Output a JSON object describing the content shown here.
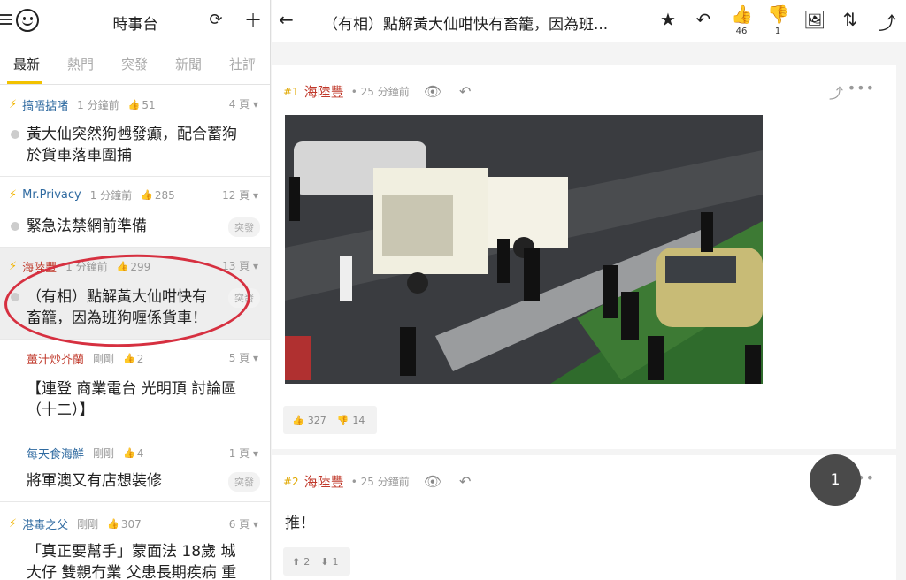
{
  "sidebar": {
    "title": "時事台",
    "tabs": [
      "最新",
      "熱門",
      "突發",
      "新聞",
      "社評"
    ],
    "topics": [
      {
        "author": "搞唔掂啫",
        "time": "1 分鐘前",
        "likes": "51",
        "pages": "4 頁",
        "title_line1": "黃大仙突然狗乸發癲，配合蓄狗",
        "title_line2": "於貨車落車圍捕",
        "tag": ""
      },
      {
        "author": "Mr.Privacy",
        "time": "1 分鐘前",
        "likes": "285",
        "pages": "12 頁",
        "title_line1": "緊急法禁網前準備",
        "title_line2": "",
        "tag": "突發"
      },
      {
        "author": "海陸豐",
        "time": "1 分鐘前",
        "likes": "299",
        "pages": "13 頁",
        "title_line1": "（有相）點解黃大仙咁快有",
        "title_line2": "畜籠，因為班狗喱係貨車！",
        "tag": "突發"
      },
      {
        "author": "薑汁炒芥蘭",
        "time": "剛剛",
        "likes": "2",
        "pages": "5 頁",
        "title_line1": "【連登 商業電台 光明頂 討論區",
        "title_line2": "（十二）】",
        "tag": ""
      },
      {
        "author": "每天食海鮮",
        "time": "剛剛",
        "likes": "4",
        "pages": "1 頁",
        "title_line1": "將軍澳又有店想裝修",
        "title_line2": "",
        "tag": "突發"
      },
      {
        "author": "港毒之父",
        "time": "剛剛",
        "likes": "307",
        "pages": "6 頁",
        "title_line1": "「真正要幫手」蒙面法 18歲 城",
        "title_line2": "大仔 雙親冇業 父患長期疾病 重",
        "tag": ""
      }
    ]
  },
  "thread": {
    "title": "（有相）點解黃大仙咁快有畜籠，因為班...",
    "like_count": "46",
    "dislike_count": "1",
    "posts": [
      {
        "floor": "#1",
        "author": "海陸豐",
        "time": "25 分鐘前",
        "up": "327",
        "down": "14",
        "text": ""
      },
      {
        "floor": "#2",
        "author": "海陸豐",
        "time": "25 分鐘前",
        "up": "2",
        "down": "1",
        "text": "推！"
      }
    ]
  },
  "page_badge": "1"
}
